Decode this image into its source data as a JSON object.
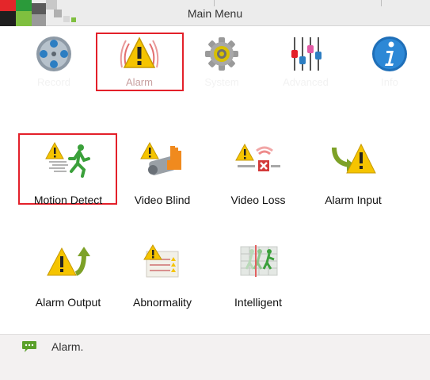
{
  "window": {
    "title": "Main Menu"
  },
  "top_nav": [
    {
      "label": "Record",
      "icon": "film-reel-icon",
      "active": false
    },
    {
      "label": "Alarm",
      "icon": "alarm-warning-icon",
      "active": true
    },
    {
      "label": "System",
      "icon": "gear-icon",
      "active": false
    },
    {
      "label": "Advanced",
      "icon": "sliders-icon",
      "active": false
    },
    {
      "label": "Info",
      "icon": "info-icon",
      "active": false
    }
  ],
  "alarm_menu": [
    {
      "label": "Motion Detect",
      "icon": "motion-detect-icon",
      "selected": true
    },
    {
      "label": "Video Blind",
      "icon": "video-blind-icon",
      "selected": false
    },
    {
      "label": "Video Loss",
      "icon": "video-loss-icon",
      "selected": false
    },
    {
      "label": "Alarm Input",
      "icon": "alarm-input-icon",
      "selected": false
    },
    {
      "label": "Alarm Output",
      "icon": "alarm-output-icon",
      "selected": false
    },
    {
      "label": "Abnormality",
      "icon": "abnormality-icon",
      "selected": false
    },
    {
      "label": "Intelligent",
      "icon": "intelligent-icon",
      "selected": false
    }
  ],
  "status": {
    "text": "Alarm.",
    "icon": "chat-bubble-icon"
  },
  "colors": {
    "selection_border": "#e3202a",
    "warning_yellow": "#f5c400",
    "accent_blue": "#2d7ec2"
  }
}
